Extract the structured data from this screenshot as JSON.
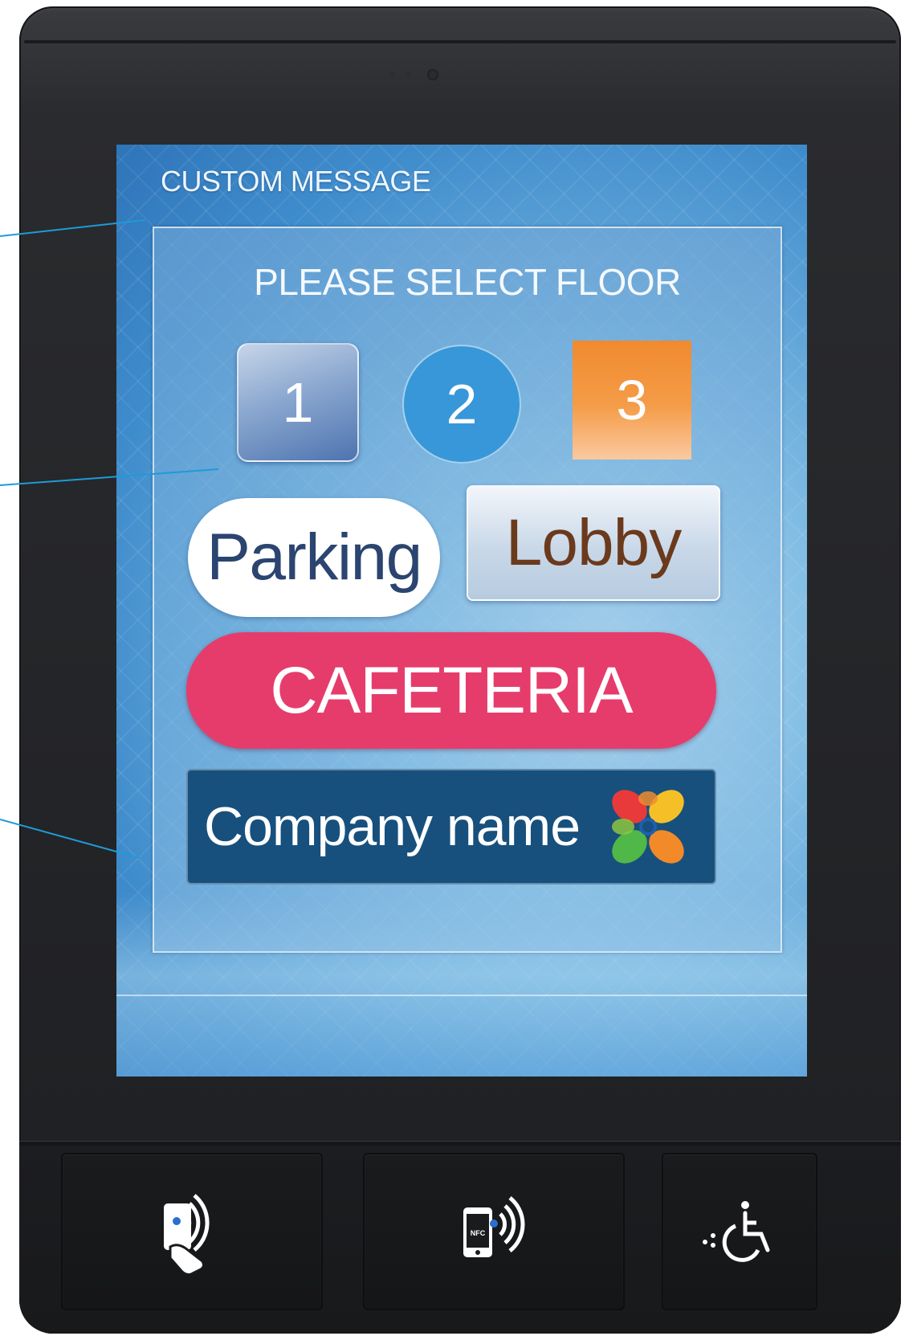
{
  "screen": {
    "custom_message": "CUSTOM MESSAGE",
    "title": "PLEASE SELECT FLOOR",
    "floors": [
      {
        "label": "1"
      },
      {
        "label": "2"
      },
      {
        "label": "3"
      }
    ],
    "parking_label": "Parking",
    "lobby_label": "Lobby",
    "cafeteria_label": "CAFETERIA",
    "company_label": "Company name"
  },
  "keys": {
    "card_reader_icon": "rfid-card-icon",
    "nfc_icon": "nfc-phone-icon",
    "nfc_text": "NFC",
    "accessibility_icon": "wheelchair-braille-icon"
  },
  "colors": {
    "floor_2": "#3797d9",
    "floor_3": "#f08a2e",
    "parking_text": "#2b4470",
    "lobby_text": "#6b3a1c",
    "cafeteria": "#e63c6c",
    "company_bg": "#17507d",
    "callout_line": "#1e9bd7"
  }
}
